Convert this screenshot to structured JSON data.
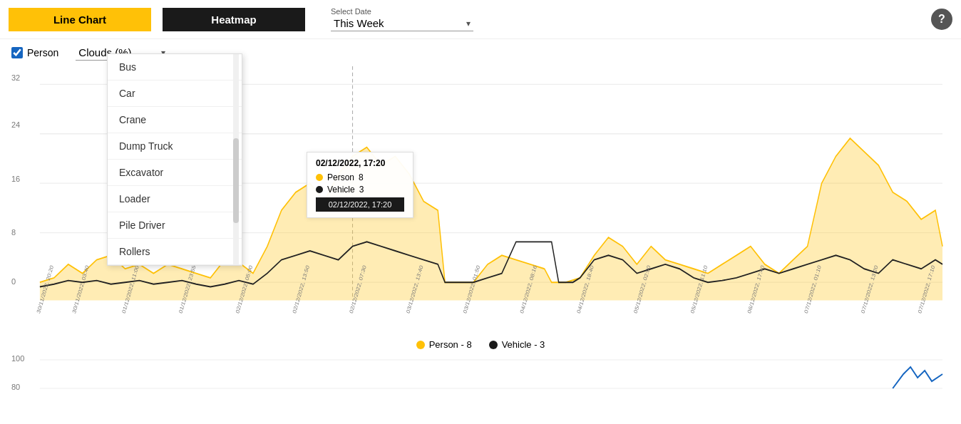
{
  "header": {
    "line_chart_label": "Line Chart",
    "heatmap_label": "Heatmap",
    "date_select_label": "Select Date",
    "date_value": "This Week",
    "help_icon": "?"
  },
  "filters": {
    "person_label": "Person",
    "person_checked": true,
    "clouds_label": "Clouds (%)"
  },
  "category_dropdown": {
    "items": [
      "Bus",
      "Car",
      "Crane",
      "Dump Truck",
      "Excavator",
      "Loader",
      "Pile Driver",
      "Rollers"
    ]
  },
  "tooltip": {
    "title": "02/12/2022, 17:20",
    "person_label": "Person",
    "person_value": "8",
    "vehicle_label": "Vehicle",
    "vehicle_value": "3",
    "footer": "02/12/2022, 17:20"
  },
  "legend": {
    "person_label": "Person - 8",
    "vehicle_label": "Vehicle - 3"
  },
  "y_axis": {
    "val32": "32",
    "val24": "24",
    "val16": "16",
    "val8": "8",
    "val0": "0"
  },
  "bottom_chart": {
    "val100": "100",
    "val80": "80"
  },
  "colors": {
    "yellow": "#FFC107",
    "black": "#1a1a1a",
    "person_dot": "#FFC107",
    "vehicle_dot": "#1a1a1a",
    "line_chart_bg": "#FFC107",
    "heatmap_bg": "#1a1a1a"
  }
}
